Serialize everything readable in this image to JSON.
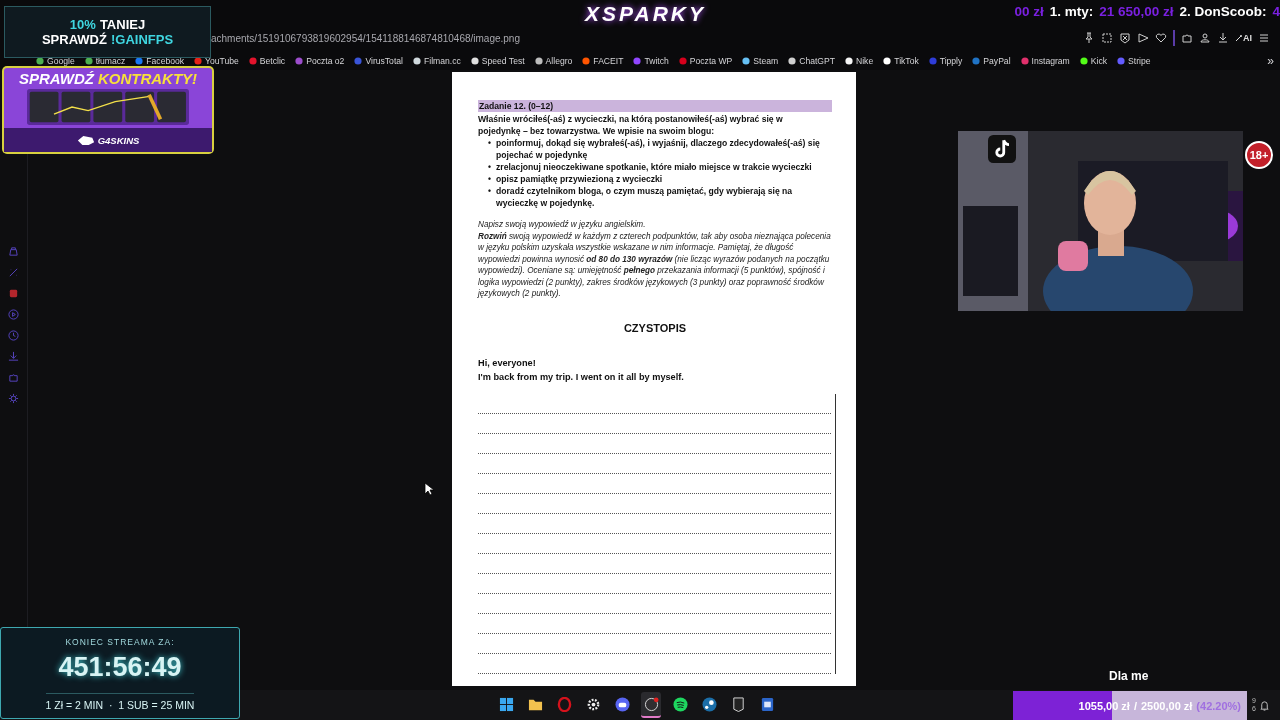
{
  "stream_overlay": {
    "logo": "XSPARKY",
    "ticker": [
      {
        "text": "00 zł",
        "kind": "amount"
      },
      {
        "text": "1. mty:",
        "kind": "name"
      },
      {
        "text": "21 650,00 zł",
        "kind": "amount"
      },
      {
        "text": "2. DonScoob:",
        "kind": "name"
      },
      {
        "text": "4",
        "kind": "amount"
      }
    ],
    "promo": [
      [
        {
          "text": "10%",
          "accent": true
        },
        {
          "text": "TANIEJ",
          "accent": false
        }
      ],
      [
        {
          "text": "SPRAWDŹ",
          "accent": false
        },
        {
          "text": "!GAINFPS",
          "accent": true
        }
      ]
    ],
    "banner": {
      "title": "SPRAWDŹ",
      "title_accent": "KONTRAKTY!",
      "brand": "G4SKINS"
    },
    "webcam": {
      "badge": "18+"
    },
    "timer": {
      "label": "KONIEC STREAMA ZA:",
      "time": "451:56:49",
      "rates": "1 Zł = 2 MIN  ·  1 SUB = 25 MIN"
    },
    "caption": "Dla me",
    "goal": {
      "raised": "1055,00 zł",
      "separator": "/",
      "target": "2500,00 zł",
      "percent": "(42.20%)",
      "level": 0.422
    }
  },
  "browser": {
    "url": "achments/1519106793819602954/1541188146874810468/image.png",
    "toolbar_ai": "AI",
    "bookmarks": [
      {
        "label": "Google",
        "color": "#4caf50"
      },
      {
        "label": "tłumacz",
        "color": "#4caf50"
      },
      {
        "label": "Facebook",
        "color": "#1877f2"
      },
      {
        "label": "YouTube",
        "color": "#e62117"
      },
      {
        "label": "Betclic",
        "color": "#e3132c"
      },
      {
        "label": "Poczta o2",
        "color": "#9c4dcc"
      },
      {
        "label": "VirusTotal",
        "color": "#3954d8"
      },
      {
        "label": "Filman.cc",
        "color": "#cfd8dc"
      },
      {
        "label": "Speed Test",
        "color": "#e0e0e0"
      },
      {
        "label": "Allegro",
        "color": "#bdbdbd"
      },
      {
        "label": "FACEIT",
        "color": "#ff5500"
      },
      {
        "label": "Twitch",
        "color": "#9146ff"
      },
      {
        "label": "Poczta WP",
        "color": "#d6001c"
      },
      {
        "label": "Steam",
        "color": "#66c0f4"
      },
      {
        "label": "ChatGPT",
        "color": "#d0d0d0"
      },
      {
        "label": "Nike",
        "color": "#f5f5f5"
      },
      {
        "label": "TikTok",
        "color": "#ffffff"
      },
      {
        "label": "Tipply",
        "color": "#2e3cd8"
      },
      {
        "label": "PayPal",
        "color": "#1f72c4"
      },
      {
        "label": "Instagram",
        "color": "#e1306c"
      },
      {
        "label": "Kick",
        "color": "#53fc18"
      },
      {
        "label": "Stripe",
        "color": "#635bff"
      }
    ],
    "more": "»"
  },
  "document": {
    "task": "Zadanie 12. (0–12)",
    "intro": "Właśnie wróciłeś(-aś) z wycieczki, na którą postanowiłeś(-aś) wybrać się w pojedynkę – bez towarzystwa. We wpisie na swoim blogu:",
    "bullet": "•",
    "bullets": [
      "poinformuj, dokąd się wybrałeś(-aś), i wyjaśnij, dlaczego zdecydowałeś(-aś) się pojechać w pojedynkę",
      "zrelacjonuj nieoczekiwane spotkanie, które miało miejsce w trakcie wycieczki",
      "opisz pamiątkę przywiezioną z wycieczki",
      "doradź czytelnikom bloga, o czym muszą pamiętać, gdy wybierają się na wycieczkę w pojedynkę."
    ],
    "instructions": [
      "Napisz swoją wypowiedź w języku angielskim.",
      "**Rozwiń** swoją wypowiedź w każdym z czterech podpunktów, tak aby osoba nieznająca polecenia w języku polskim uzyskała wszystkie wskazane w nim informacje. Pamiętaj, że długość wypowiedzi powinna wynosić **od 80 do 130 wyrazów** (nie licząc wyrazów podanych na początku wypowiedzi). Oceniane są: umiejętność **pełnego** przekazania informacji (5 punktów), spójność i logika wypowiedzi (2 punkty), zakres środków językowych (3 punkty) oraz poprawność środków językowych (2 punkty)."
    ],
    "heading": "CZYSTOPIS",
    "answer": [
      "Hi, everyone!",
      "I'm back from my trip. I went on it all by myself."
    ]
  },
  "taskbar": {
    "apps": [
      {
        "kind": "windows",
        "selected": false
      },
      {
        "kind": "folder",
        "selected": false
      },
      {
        "kind": "opera",
        "selected": false
      },
      {
        "kind": "steelseries",
        "selected": false
      },
      {
        "kind": "discord",
        "selected": false
      },
      {
        "kind": "obs",
        "selected": true
      },
      {
        "kind": "spotify",
        "selected": false
      },
      {
        "kind": "steam",
        "selected": false
      },
      {
        "kind": "epic",
        "selected": false
      },
      {
        "kind": "word",
        "selected": false
      }
    ],
    "clock": [
      "9",
      "6"
    ]
  }
}
